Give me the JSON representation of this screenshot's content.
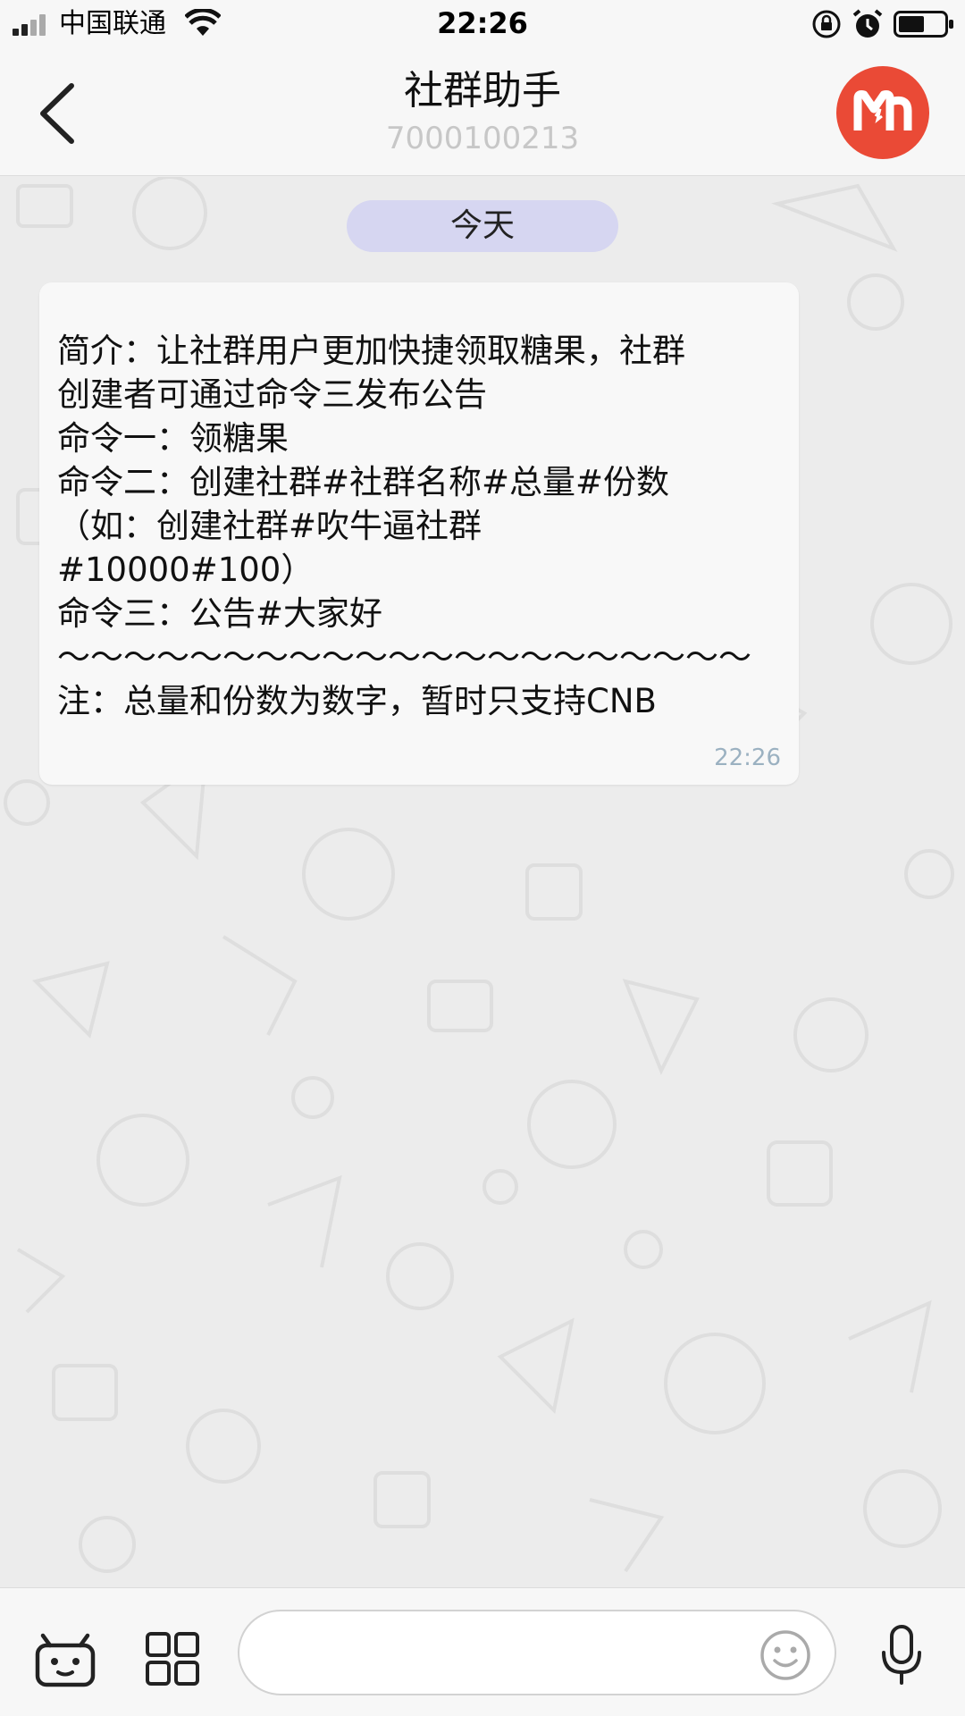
{
  "status_bar": {
    "carrier": "中国联通",
    "time": "22:26"
  },
  "header": {
    "title": "社群助手",
    "subtitle": "7000100213",
    "avatar_color": "#ea4a36"
  },
  "chat": {
    "date_label": "今天",
    "message": {
      "lines": [
        "简介：让社群用户更加快捷领取糖果，社群",
        "创建者可通过命令三发布公告",
        "命令一：领糖果",
        "命令二：创建社群#社群名称#总量#份数",
        "（如：创建社群#吹牛逼社群",
        "#10000#100）",
        "命令三：公告#大家好",
        "～～～～～～～～～～～～～～～～～～～～～",
        "注：总量和份数为数字，暂时只支持CNB"
      ],
      "time": "22:26"
    }
  },
  "input_bar": {
    "placeholder": ""
  },
  "icons": [
    "signal-icon",
    "wifi-icon",
    "orientation-lock-icon",
    "alarm-icon",
    "battery-icon",
    "back-chevron-icon",
    "bot-icon",
    "grid-icon",
    "emoji-icon",
    "microphone-icon"
  ]
}
